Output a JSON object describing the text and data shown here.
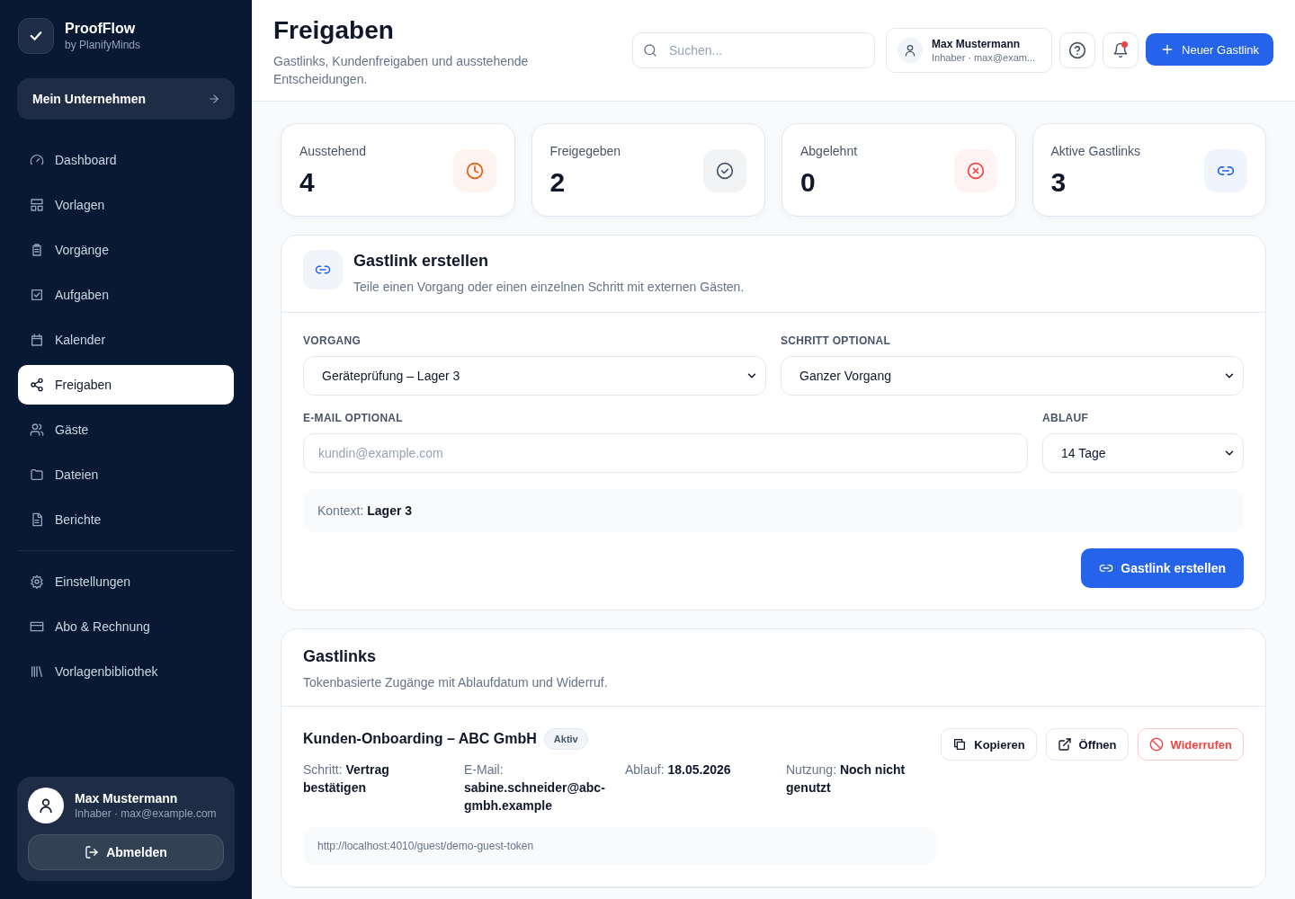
{
  "brand": {
    "name": "ProofFlow",
    "subtitle": "by PlanifyMinds"
  },
  "company_button": "Mein Unternehmen",
  "nav_main": [
    {
      "label": "Dashboard",
      "kind": "gauge",
      "selected": false
    },
    {
      "label": "Vorlagen",
      "kind": "layout",
      "selected": false
    },
    {
      "label": "Vorgänge",
      "kind": "clipboard",
      "selected": false
    },
    {
      "label": "Aufgaben",
      "kind": "checksquare",
      "selected": false
    },
    {
      "label": "Kalender",
      "kind": "calendar",
      "selected": false
    },
    {
      "label": "Freigaben",
      "kind": "share",
      "selected": true
    },
    {
      "label": "Gäste",
      "kind": "users",
      "selected": false
    },
    {
      "label": "Dateien",
      "kind": "folder",
      "selected": false
    },
    {
      "label": "Berichte",
      "kind": "file",
      "selected": false
    }
  ],
  "nav_settings": [
    {
      "label": "Einstellungen",
      "kind": "gear",
      "selected": false
    },
    {
      "label": "Abo & Rechnung",
      "kind": "card",
      "selected": false
    },
    {
      "label": "Vorlagenbibliothek",
      "kind": "library",
      "selected": false
    }
  ],
  "user_card": {
    "name": "Max Mustermann",
    "meta": "Inhaber · max@example.com",
    "logout": "Abmelden"
  },
  "header": {
    "title": "Freigaben",
    "subtitle": "Gastlinks, Kundenfreigaben und ausstehende Entscheidungen.",
    "search_placeholder": "Suchen...",
    "user_name": "Max Mustermann",
    "user_meta": "Inhaber · max@exam...",
    "notifications_unread": true,
    "new_button": "Neuer Gastlink"
  },
  "stats": [
    {
      "label": "Ausstehend",
      "value": "4",
      "kind": "clock",
      "color": "#ea580c"
    },
    {
      "label": "Freigegeben",
      "value": "2",
      "kind": "checkcircle",
      "color": "#475569"
    },
    {
      "label": "Abgelehnt",
      "value": "0",
      "kind": "xcircle",
      "color": "#ef4444"
    },
    {
      "label": "Aktive Gastlinks",
      "value": "3",
      "kind": "link",
      "color": "#2563eb"
    }
  ],
  "create_form": {
    "title": "Gastlink erstellen",
    "subtitle": "Teile einen Vorgang oder einen einzelnen Schritt mit externen Gästen.",
    "vorgang_label": "VORGANG",
    "vorgang_value": "Geräteprüfung – Lager 3",
    "schritt_label": "SCHRITT OPTIONAL",
    "schritt_value": "Ganzer Vorgang",
    "email_label": "E-MAIL OPTIONAL",
    "email_placeholder": "kundin@example.com",
    "ablauf_label": "ABLAUF",
    "ablauf_value": "14 Tage",
    "context": "Kontext: **Lager 3**",
    "submit": "Gastlink erstellen"
  },
  "guest_links": {
    "title": "Gastlinks",
    "subtitle": "Tokenbasierte Zugänge mit Ablaufdatum und Widerruf.",
    "items": [
      {
        "title": "Kunden-Onboarding – ABC GmbH",
        "status": "Aktiv",
        "details": [
          "Schritt: **Vertrag bestätigen**",
          "E-Mail: **sabine.schneider@abc-gmbh.example**",
          "Ablauf: **18.05.2026**",
          "Nutzung: **Noch nicht genutzt**"
        ],
        "url": "http://localhost:4010/guest/demo-guest-token",
        "actions": [
          {
            "label": "Kopieren",
            "kind": "copy"
          },
          {
            "label": "Öffnen",
            "kind": "open"
          },
          {
            "label": "Widerrufen",
            "kind": "revoke"
          }
        ]
      }
    ]
  }
}
